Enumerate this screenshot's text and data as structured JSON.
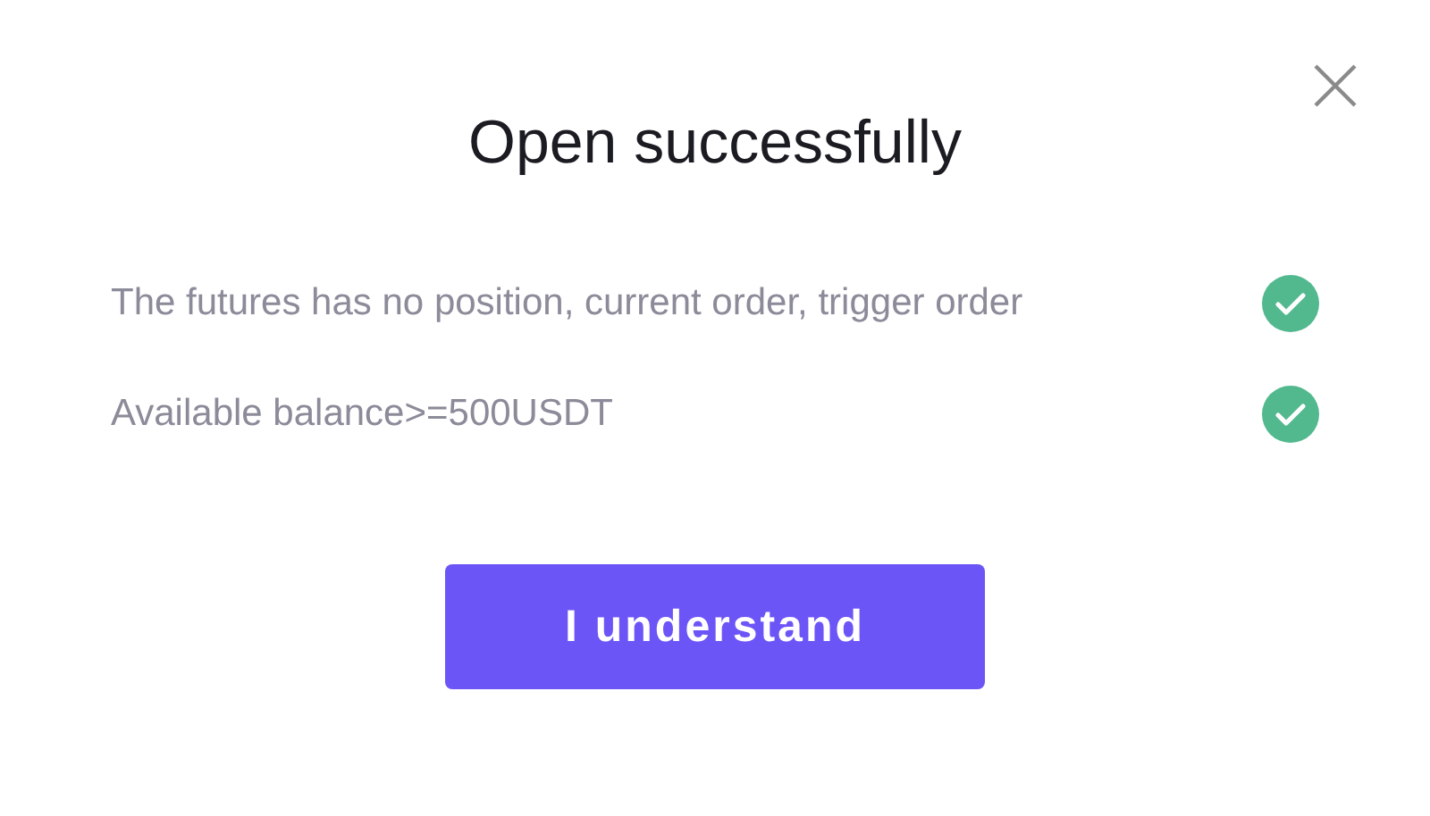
{
  "dialog": {
    "title": "Open successfully",
    "conditions": [
      {
        "text": "The futures has no position, current order, trigger order",
        "met": true
      },
      {
        "text": "Available balance>=500USDT",
        "met": true
      }
    ],
    "button": "I understand"
  }
}
